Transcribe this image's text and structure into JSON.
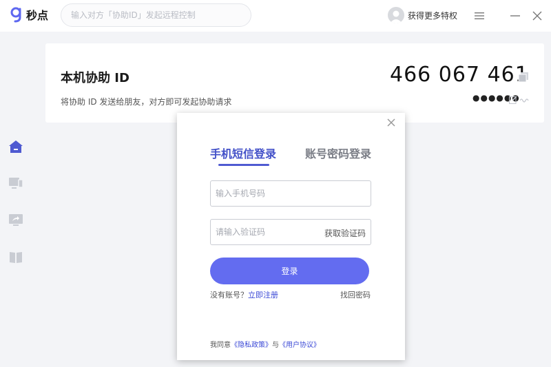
{
  "app": {
    "name": "秒点"
  },
  "search": {
    "placeholder": "输入对方「协助ID」发起远程控制"
  },
  "user": {
    "label": "获得更多特权"
  },
  "sidebar": {
    "items": [
      {
        "icon": "home-icon",
        "active": true
      },
      {
        "icon": "device-icon",
        "active": false
      },
      {
        "icon": "screen-share-icon",
        "active": false
      },
      {
        "icon": "book-icon",
        "active": false
      }
    ]
  },
  "card": {
    "title": "本机协助 ID",
    "description": "将协助 ID 发送给朋友，对方即可发起协助请求",
    "id": "466 067 461",
    "password_mask": "●●●●●●"
  },
  "login": {
    "tab_sms": "手机短信登录",
    "tab_password": "账号密码登录",
    "phone_placeholder": "输入手机号码",
    "code_placeholder": "请输入验证码",
    "get_code": "获取验证码",
    "submit": "登录",
    "no_account": "没有账号？",
    "register": "立即注册",
    "forgot": "找回密码",
    "agree_prefix": "我同意",
    "privacy": "《隐私政策》",
    "agree_and": "与",
    "user_agreement": "《用户协议》"
  },
  "colors": {
    "accent": "#636cf0",
    "tab_active": "#4250c8",
    "sidebar_active": "#4f5ad1",
    "sidebar_icon": "#c9ccd3"
  }
}
